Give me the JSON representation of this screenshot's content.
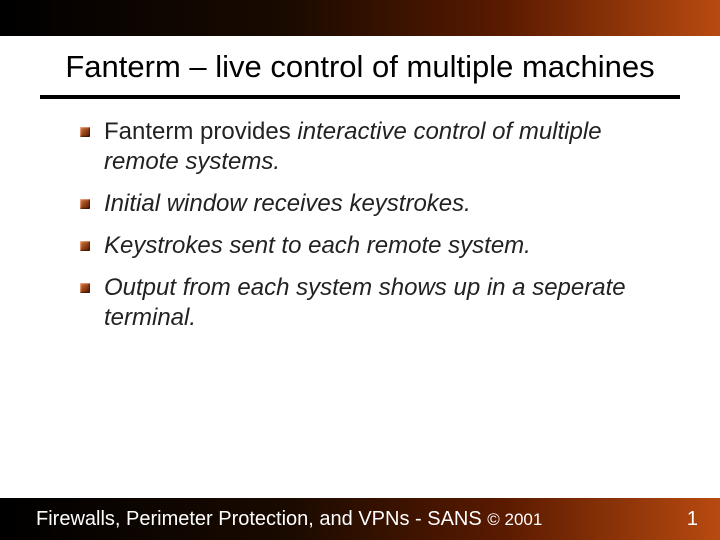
{
  "title": "Fanterm – live control of multiple machines",
  "bullets": [
    {
      "lead": "Fanterm provides ",
      "ital": "interactive control of multiple remote systems."
    },
    {
      "lead": "",
      "ital": "Initial window receives keystrokes."
    },
    {
      "lead": "",
      "ital": "Keystrokes sent to each remote system."
    },
    {
      "lead": "",
      "ital": "Output from each system shows up in a seperate terminal."
    }
  ],
  "footer": {
    "text": "Firewalls, Perimeter Protection, and VPNs - SANS ",
    "copyright": "© 2001",
    "page": "1"
  },
  "colors": {
    "accent": "#b84a10"
  }
}
